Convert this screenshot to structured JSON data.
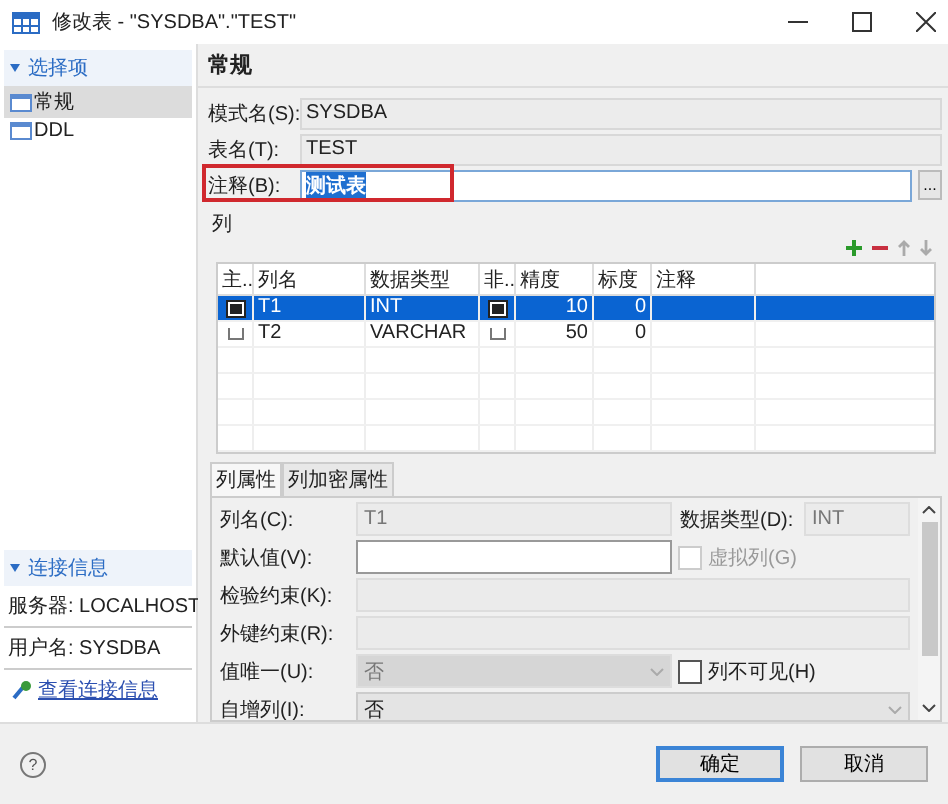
{
  "window": {
    "title": "修改表 - \"SYSDBA\".\"TEST\""
  },
  "sidebar": {
    "title": "选择项",
    "items": [
      {
        "label": "常规",
        "selected": true
      },
      {
        "label": "DDL",
        "selected": false
      }
    ]
  },
  "connection": {
    "title": "连接信息",
    "lines": [
      "服务器: LOCALHOST",
      "用户名: SYSDBA"
    ],
    "link": "查看连接信息"
  },
  "page_title": "常规",
  "fields": [
    {
      "label": "模式名(S):",
      "value": "SYSDBA",
      "editable": false,
      "highlighted": false
    },
    {
      "label": "表名(T):",
      "value": "TEST",
      "editable": false,
      "highlighted": false
    },
    {
      "label": "注释(B):",
      "value": "测试表",
      "editable": true,
      "highlighted": true,
      "button": "..."
    }
  ],
  "columns_section": {
    "title": "列",
    "table": {
      "columns": [
        "主..",
        "列名",
        "数据类型",
        "非..",
        "精度",
        "标度",
        "注释"
      ],
      "rows": [
        {
          "primary_key": true,
          "name": "T1",
          "type": "INT",
          "not_null": true,
          "precision": "10",
          "scale": "0",
          "selected": true
        },
        {
          "primary_key": false,
          "name": "T2",
          "type": "VARCHAR",
          "not_null": false,
          "precision": "50",
          "scale": "0",
          "selected": false
        }
      ]
    }
  },
  "tabs": [
    {
      "label": "列属性",
      "selected": true
    },
    {
      "label": "列加密属性",
      "selected": false
    }
  ],
  "properties": [
    {
      "label": "列名(C):",
      "field": {
        "kind": "text",
        "value": "T1",
        "disabled": true
      },
      "side": {
        "kind": "field",
        "label": "数据类型(D):",
        "value": "INT",
        "disabled": true
      }
    },
    {
      "label": "默认值(V):",
      "field": {
        "kind": "text",
        "disabled": false
      },
      "side": {
        "kind": "checkbox",
        "label": "虚拟列(G)",
        "checked": false,
        "disabled": true
      }
    },
    {
      "label": "检验约束(K):",
      "field": {
        "kind": "text",
        "disabled": true
      }
    },
    {
      "label": "外键约束(R):",
      "field": {
        "kind": "text",
        "disabled": true
      }
    },
    {
      "label": "值唯一(U):",
      "field": {
        "kind": "select",
        "value": "否",
        "disabled": true
      },
      "side": {
        "kind": "checkbox",
        "label": "列不可见(H)",
        "checked": false,
        "disabled": false
      }
    },
    {
      "label": "自增列(I):",
      "field": {
        "kind": "select",
        "value": "否",
        "disabled": false
      }
    }
  ],
  "help": "?",
  "buttons": [
    {
      "label": "确定",
      "default": true
    },
    {
      "label": "取消",
      "default": false
    }
  ]
}
